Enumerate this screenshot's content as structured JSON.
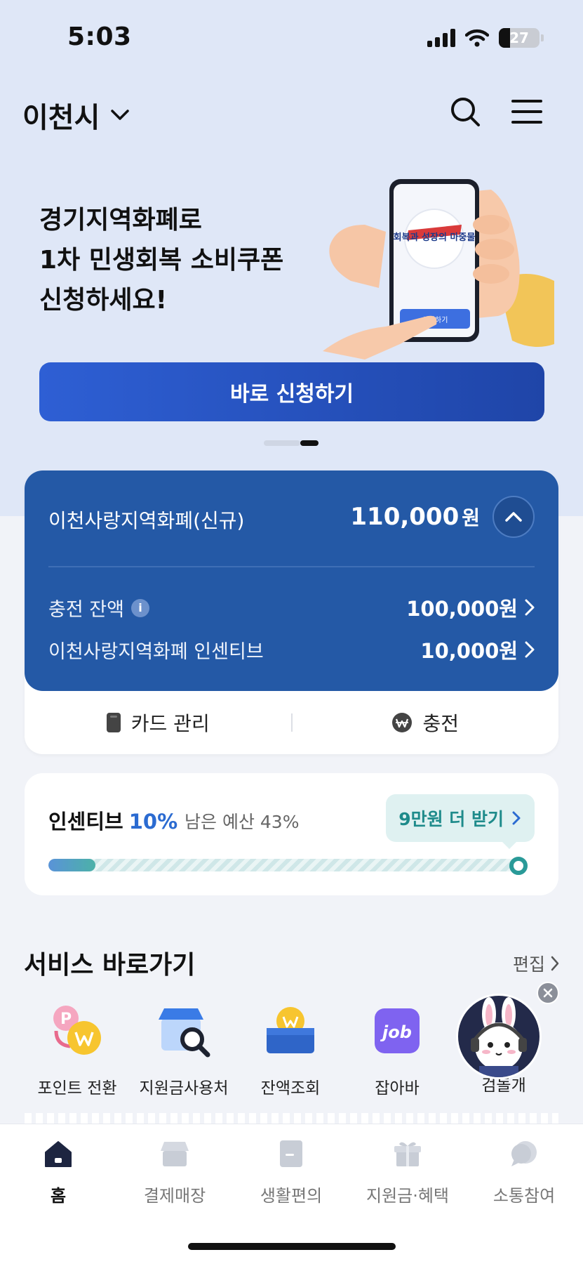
{
  "status": {
    "time": "5:03",
    "battery": "27"
  },
  "header": {
    "city": "이천시"
  },
  "banner": {
    "title_lines": [
      "경기지역화폐로",
      "1차 민생회복 소비쿠폰",
      "신청하세요!"
    ],
    "cta": "바로 신청하기",
    "phone_screen_title": "회복과 성장의 마중물",
    "phone_screen_btn": "신청하기"
  },
  "balance": {
    "card_name": "이천사랑지역화폐(신규)",
    "total": "110,000",
    "total_unit": "원",
    "rows": [
      {
        "label": "충전 잔액",
        "value": "100,000원"
      },
      {
        "label": "이천사랑지역화폐 인센티브",
        "value": "10,000원"
      }
    ],
    "actions": {
      "card": "카드 관리",
      "charge": "충전"
    }
  },
  "incentive": {
    "title": "인센티브",
    "percent": "10%",
    "remaining": "남은 예산 43%",
    "more": "9만원 더 받기",
    "progress": 0.1
  },
  "services": {
    "title": "서비스 바로가기",
    "edit": "편집",
    "items": [
      {
        "label": "포인트 전환",
        "icon": "point-convert-icon"
      },
      {
        "label": "지원금사용처",
        "icon": "store-search-icon"
      },
      {
        "label": "잔액조회",
        "icon": "wallet-icon"
      },
      {
        "label": "잡아바",
        "icon": "job-icon"
      },
      {
        "label": "검돌개",
        "icon": "chatbot-icon"
      }
    ]
  },
  "nav": {
    "items": [
      {
        "label": "홈",
        "icon": "home-icon",
        "active": true
      },
      {
        "label": "결제매장",
        "icon": "store-icon"
      },
      {
        "label": "생활편의",
        "icon": "document-icon"
      },
      {
        "label": "지원금·혜택",
        "icon": "gift-icon"
      },
      {
        "label": "소통참여",
        "icon": "chat-icon"
      }
    ]
  },
  "colors": {
    "primary": "#2459a6",
    "accent": "#2b6bd1",
    "teal": "#1e8b8b",
    "hero_bg": "#dfe7f7"
  }
}
